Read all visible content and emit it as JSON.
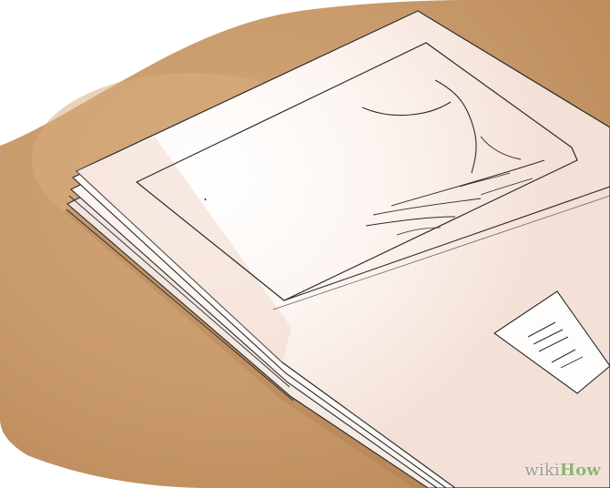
{
  "scene": {
    "subject": "magazine-stack-on-table",
    "colors": {
      "table": "#c99a6b",
      "table_shadow": "#b98858",
      "paper": "#fffdfb",
      "paper_warm": "#f6e7df",
      "line": "#2b2b2b"
    }
  },
  "watermark": {
    "prefix": "wiki",
    "suffix": "How",
    "prefix_color": "#9a9a9a",
    "suffix_color": "#8fb26f"
  }
}
